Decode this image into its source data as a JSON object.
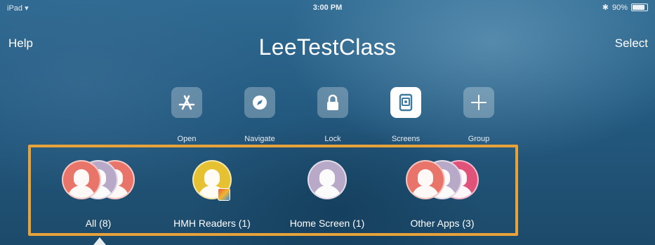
{
  "status": {
    "device": "iPad",
    "time": "3:00 PM",
    "battery": "90%"
  },
  "nav": {
    "help_label": "Help",
    "title": "LeeTestClass",
    "select_label": "Select"
  },
  "actions": [
    {
      "label": "Open",
      "icon": "app-store-icon"
    },
    {
      "label": "Navigate",
      "icon": "compass-icon"
    },
    {
      "label": "Lock",
      "icon": "lock-icon"
    },
    {
      "label": "Screens",
      "icon": "screens-icon",
      "active": true
    },
    {
      "label": "Group",
      "icon": "plus-icon"
    }
  ],
  "groups": [
    {
      "label": "All (8)"
    },
    {
      "label": "HMH Readers (1)"
    },
    {
      "label": "Home Screen (1)"
    },
    {
      "label": "Other Apps (3)"
    }
  ],
  "colors": {
    "highlight_frame": "#e8a23a",
    "avatar_coral": "#e9756a",
    "avatar_lilac": "#b9a9c9",
    "avatar_yellow": "#e6c232",
    "avatar_pink": "#e0527a"
  }
}
